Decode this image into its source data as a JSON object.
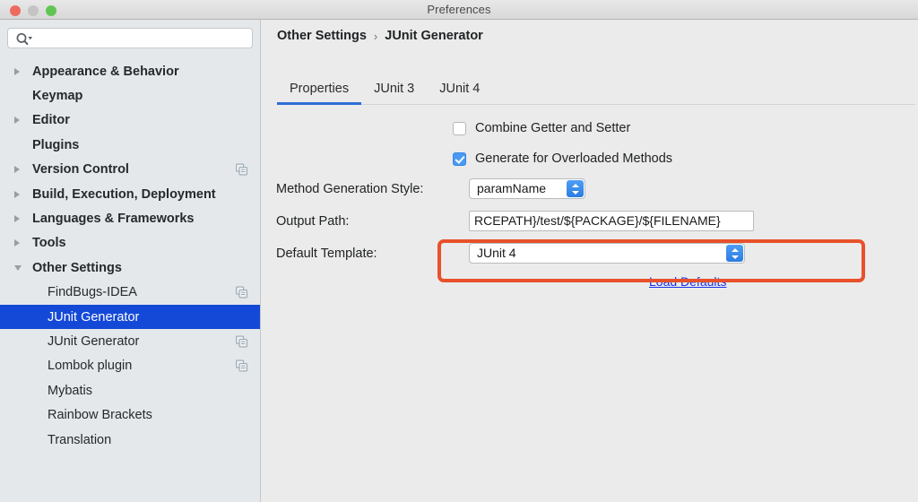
{
  "window": {
    "title": "Preferences",
    "traffic_lights": [
      "close",
      "minimize",
      "maximize"
    ]
  },
  "sidebar": {
    "search": {
      "value": "",
      "placeholder": "",
      "icon": "search-icon"
    },
    "items": [
      {
        "label": "Appearance & Behavior",
        "twisty": "closed",
        "bold": true,
        "child": false,
        "selected": false,
        "badge": false
      },
      {
        "label": "Keymap",
        "twisty": "none",
        "bold": true,
        "child": false,
        "selected": false,
        "badge": false
      },
      {
        "label": "Editor",
        "twisty": "closed",
        "bold": true,
        "child": false,
        "selected": false,
        "badge": false
      },
      {
        "label": "Plugins",
        "twisty": "none",
        "bold": true,
        "child": false,
        "selected": false,
        "badge": false
      },
      {
        "label": "Version Control",
        "twisty": "closed",
        "bold": true,
        "child": false,
        "selected": false,
        "badge": true
      },
      {
        "label": "Build, Execution, Deployment",
        "twisty": "closed",
        "bold": true,
        "child": false,
        "selected": false,
        "badge": false
      },
      {
        "label": "Languages & Frameworks",
        "twisty": "closed",
        "bold": true,
        "child": false,
        "selected": false,
        "badge": false
      },
      {
        "label": "Tools",
        "twisty": "closed",
        "bold": true,
        "child": false,
        "selected": false,
        "badge": false
      },
      {
        "label": "Other Settings",
        "twisty": "open",
        "bold": true,
        "child": false,
        "selected": false,
        "badge": false
      },
      {
        "label": "FindBugs-IDEA",
        "twisty": "none",
        "bold": false,
        "child": true,
        "selected": false,
        "badge": true
      },
      {
        "label": "JUnit Generator",
        "twisty": "none",
        "bold": false,
        "child": true,
        "selected": true,
        "badge": false
      },
      {
        "label": "JUnit Generator",
        "twisty": "none",
        "bold": false,
        "child": true,
        "selected": false,
        "badge": true
      },
      {
        "label": "Lombok plugin",
        "twisty": "none",
        "bold": false,
        "child": true,
        "selected": false,
        "badge": true
      },
      {
        "label": "Mybatis",
        "twisty": "none",
        "bold": false,
        "child": true,
        "selected": false,
        "badge": false
      },
      {
        "label": "Rainbow Brackets",
        "twisty": "none",
        "bold": false,
        "child": true,
        "selected": false,
        "badge": false
      },
      {
        "label": "Translation",
        "twisty": "none",
        "bold": false,
        "child": true,
        "selected": false,
        "badge": false
      }
    ]
  },
  "breadcrumb": {
    "root": "Other Settings",
    "separator": "›",
    "current": "JUnit Generator"
  },
  "tabs": [
    {
      "label": "Properties",
      "active": true
    },
    {
      "label": "JUnit 3",
      "active": false
    },
    {
      "label": "JUnit 4",
      "active": false
    }
  ],
  "form": {
    "checkboxes": [
      {
        "label": "Combine Getter and Setter",
        "checked": false
      },
      {
        "label": "Generate for Overloaded Methods",
        "checked": true
      }
    ],
    "method_generation_style": {
      "label": "Method Generation Style:",
      "value": "paramName"
    },
    "output_path": {
      "label": "Output Path:",
      "value": "RCEPATH}/test/${PACKAGE}/${FILENAME}"
    },
    "default_template": {
      "label": "Default Template:",
      "value": "JUnit 4"
    },
    "load_defaults_link": "Load Defaults"
  },
  "annotation": {
    "highlight_color": "#e8512b",
    "link_color": "#1a33e8",
    "selection_color": "#1449d8",
    "accent_color": "#2d6fd4"
  }
}
